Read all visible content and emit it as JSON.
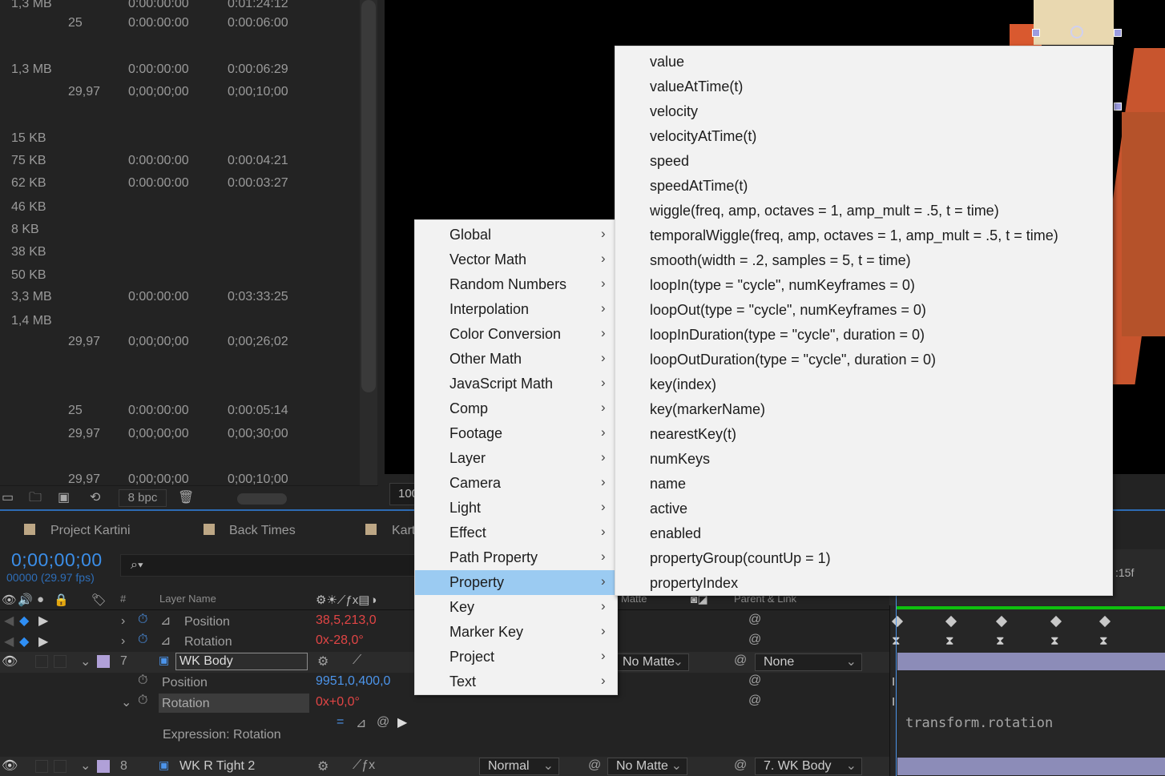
{
  "project_panel": {
    "rows": [
      {
        "size": "1,3 MB",
        "fps": "",
        "in": "0:00:00:00",
        "dur": "0:01:24:12"
      },
      {
        "size": "",
        "fps": "25",
        "in": "0:00:00:00",
        "dur": "0:00:06:00"
      },
      {
        "size": "1,3 MB",
        "fps": "",
        "in": "0:00:00:00",
        "dur": "0:00:06:29"
      },
      {
        "size": "",
        "fps": "29,97",
        "in": "0;00;00;00",
        "dur": "0;00;10;00"
      },
      {
        "size": "15 KB",
        "fps": "",
        "in": "",
        "dur": ""
      },
      {
        "size": "75 KB",
        "fps": "",
        "in": "0:00:00:00",
        "dur": "0:00:04:21"
      },
      {
        "size": "62 KB",
        "fps": "",
        "in": "0:00:00:00",
        "dur": "0:00:03:27"
      },
      {
        "size": "46 KB",
        "fps": "",
        "in": "",
        "dur": ""
      },
      {
        "size": "8 KB",
        "fps": "",
        "in": "",
        "dur": ""
      },
      {
        "size": "38 KB",
        "fps": "",
        "in": "",
        "dur": ""
      },
      {
        "size": "50 KB",
        "fps": "",
        "in": "",
        "dur": ""
      },
      {
        "size": "3,3 MB",
        "fps": "",
        "in": "0:00:00:00",
        "dur": "0:03:33:25"
      },
      {
        "size": "1,4 MB",
        "fps": "",
        "in": "",
        "dur": ""
      },
      {
        "size": "",
        "fps": "29,97",
        "in": "0;00;00;00",
        "dur": "0;00;26;02"
      },
      {
        "size": "",
        "fps": "25",
        "in": "0:00:00:00",
        "dur": "0:00:05:14"
      },
      {
        "size": "",
        "fps": "29,97",
        "in": "0;00;00;00",
        "dur": "0;00;30;00"
      },
      {
        "size": "",
        "fps": "29,97",
        "in": "0;00;00;00",
        "dur": "0;00;10;00"
      }
    ],
    "footer": {
      "bpc": "8 bpc"
    }
  },
  "viewer": {
    "zoom": "100%"
  },
  "timeline": {
    "tabs": [
      "Project Kartini",
      "Back Times",
      "Karti"
    ],
    "current_time": "0;00;00;00",
    "frames": "00000 (29.97 fps)",
    "search_icon": "⌕▾",
    "header": {
      "num": "#",
      "layer_name": "Layer Name",
      "matte": "Matte",
      "parent": "Parent & Link"
    },
    "rows": {
      "pos1": {
        "label": "Position",
        "value": "38,5,213,0"
      },
      "rot1": {
        "label": "Rotation",
        "value": "0x-28,0°"
      },
      "layer7": {
        "num": "7",
        "name": "WK Body",
        "matte": "No Matte",
        "parent": "None"
      },
      "pos2": {
        "label": "Position",
        "value": "9951,0,400,0"
      },
      "rot2": {
        "label": "Rotation",
        "value": "0x+0,0°"
      },
      "expr": {
        "label": "Expression: Rotation"
      },
      "layer8": {
        "num": "8",
        "name": "WK R Tight 2",
        "mode": "Normal",
        "matte": "No Matte",
        "parent": "7. WK Body"
      }
    },
    "ruler_label": ":15f",
    "expression_text": "transform.rotation"
  },
  "menu_main": {
    "items": [
      "Global",
      "Vector Math",
      "Random Numbers",
      "Interpolation",
      "Color Conversion",
      "Other Math",
      "JavaScript Math",
      "Comp",
      "Footage",
      "Layer",
      "Camera",
      "Light",
      "Effect",
      "Path Property",
      "Property",
      "Key",
      "Marker Key",
      "Project",
      "Text"
    ],
    "highlighted": "Property"
  },
  "menu_sub": {
    "items": [
      "value",
      "valueAtTime(t)",
      "velocity",
      "velocityAtTime(t)",
      "speed",
      "speedAtTime(t)",
      "wiggle(freq, amp, octaves = 1, amp_mult = .5, t = time)",
      "temporalWiggle(freq, amp, octaves = 1, amp_mult = .5, t = time)",
      "smooth(width = .2, samples = 5, t = time)",
      "loopIn(type = \"cycle\", numKeyframes = 0)",
      "loopOut(type = \"cycle\", numKeyframes = 0)",
      "loopInDuration(type = \"cycle\", duration = 0)",
      "loopOutDuration(type = \"cycle\", duration = 0)",
      "key(index)",
      "key(markerName)",
      "nearestKey(t)",
      "numKeys",
      "name",
      "active",
      "enabled",
      "propertyGroup(countUp = 1)",
      "propertyIndex"
    ]
  },
  "colors": {
    "accent": "#4c94ea",
    "highlight": "#9bcbf2",
    "value_red": "#e14545",
    "keyframe_green": "#0ec00e"
  }
}
